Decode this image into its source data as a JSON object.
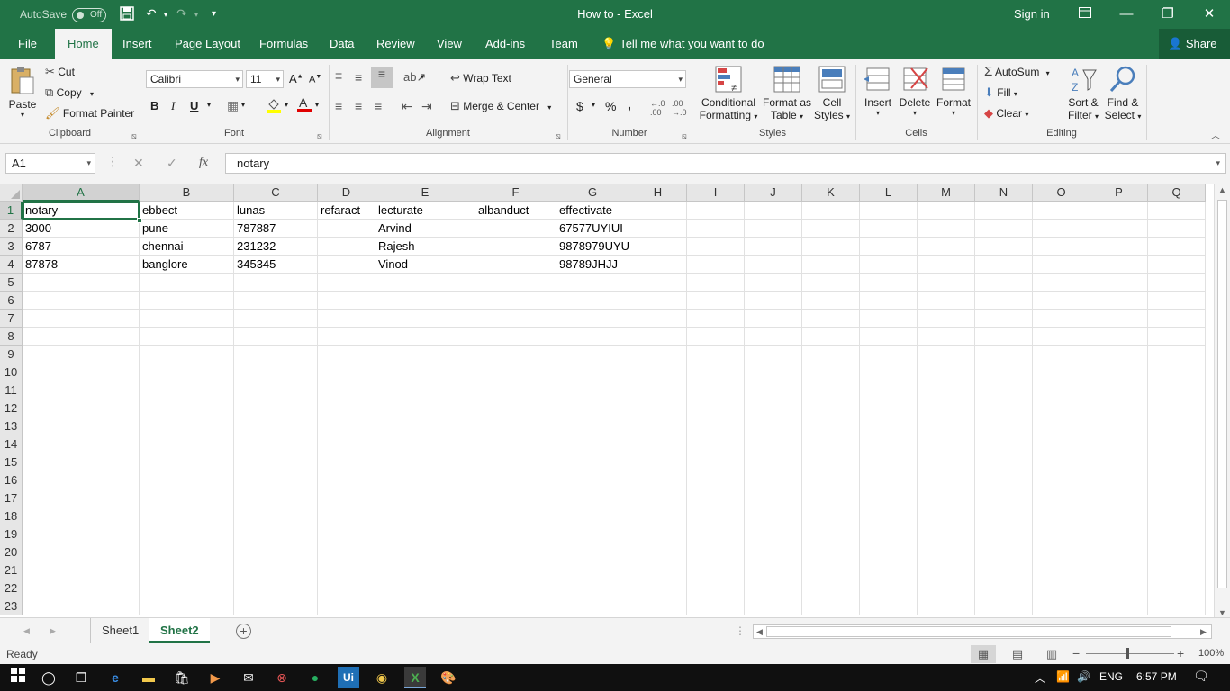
{
  "titlebar": {
    "autosave_label": "AutoSave",
    "autosave_state": "Off",
    "title": "How to  -  Excel",
    "signin": "Sign in"
  },
  "tabs": [
    "File",
    "Home",
    "Insert",
    "Page Layout",
    "Formulas",
    "Data",
    "Review",
    "View",
    "Add-ins",
    "Team"
  ],
  "active_tab": "Home",
  "tellme": "Tell me what you want to do",
  "share": "Share",
  "ribbon": {
    "clipboard": {
      "label": "Clipboard",
      "paste": "Paste",
      "cut": "Cut",
      "copy": "Copy",
      "format_painter": "Format Painter"
    },
    "font": {
      "label": "Font",
      "name": "Calibri",
      "size": "11",
      "bold": "B",
      "italic": "I",
      "underline": "U"
    },
    "alignment": {
      "label": "Alignment",
      "wrap_text": "Wrap Text",
      "merge_center": "Merge & Center"
    },
    "number": {
      "label": "Number",
      "format": "General",
      "currency": "$",
      "percent": "%",
      "comma": ","
    },
    "styles": {
      "label": "Styles",
      "conditional_1": "Conditional",
      "conditional_2": "Formatting",
      "format_table_1": "Format as",
      "format_table_2": "Table",
      "cell_styles_1": "Cell",
      "cell_styles_2": "Styles"
    },
    "cells": {
      "label": "Cells",
      "insert": "Insert",
      "delete": "Delete",
      "format": "Format"
    },
    "editing": {
      "label": "Editing",
      "autosum": "AutoSum",
      "fill": "Fill",
      "clear": "Clear",
      "sort_1": "Sort &",
      "sort_2": "Filter",
      "find_1": "Find &",
      "find_2": "Select"
    }
  },
  "formula_bar": {
    "name_box": "A1",
    "fx": "fx",
    "content": "notary"
  },
  "grid": {
    "columns": [
      "A",
      "B",
      "C",
      "D",
      "E",
      "F",
      "G",
      "H",
      "I",
      "J",
      "K",
      "L",
      "M",
      "N",
      "O",
      "P",
      "Q"
    ],
    "row_count": 23,
    "selected_cell": "A1",
    "rows": [
      [
        "notary",
        "ebbect",
        "lunas",
        "refaract",
        "lecturate",
        "albanduct",
        "effectivate"
      ],
      [
        "3000",
        "pune",
        "787887",
        "",
        "Arvind",
        "",
        "67577UYIUI"
      ],
      [
        "6787",
        "chennai",
        "231232",
        "",
        "Rajesh",
        "",
        "9878979UYU"
      ],
      [
        "87878",
        "banglore",
        "345345",
        "",
        "Vinod",
        "",
        "98789JHJJ"
      ]
    ]
  },
  "sheets": [
    "Sheet1",
    "Sheet2"
  ],
  "active_sheet": "Sheet2",
  "status": {
    "ready": "Ready",
    "zoom": "100%"
  },
  "taskbar": {
    "lang": "ENG",
    "time": "6:57 PM"
  },
  "colors": {
    "excel_green": "#217346",
    "ribbon_bg": "#f3f3f3",
    "taskbar_bg": "#101010"
  }
}
